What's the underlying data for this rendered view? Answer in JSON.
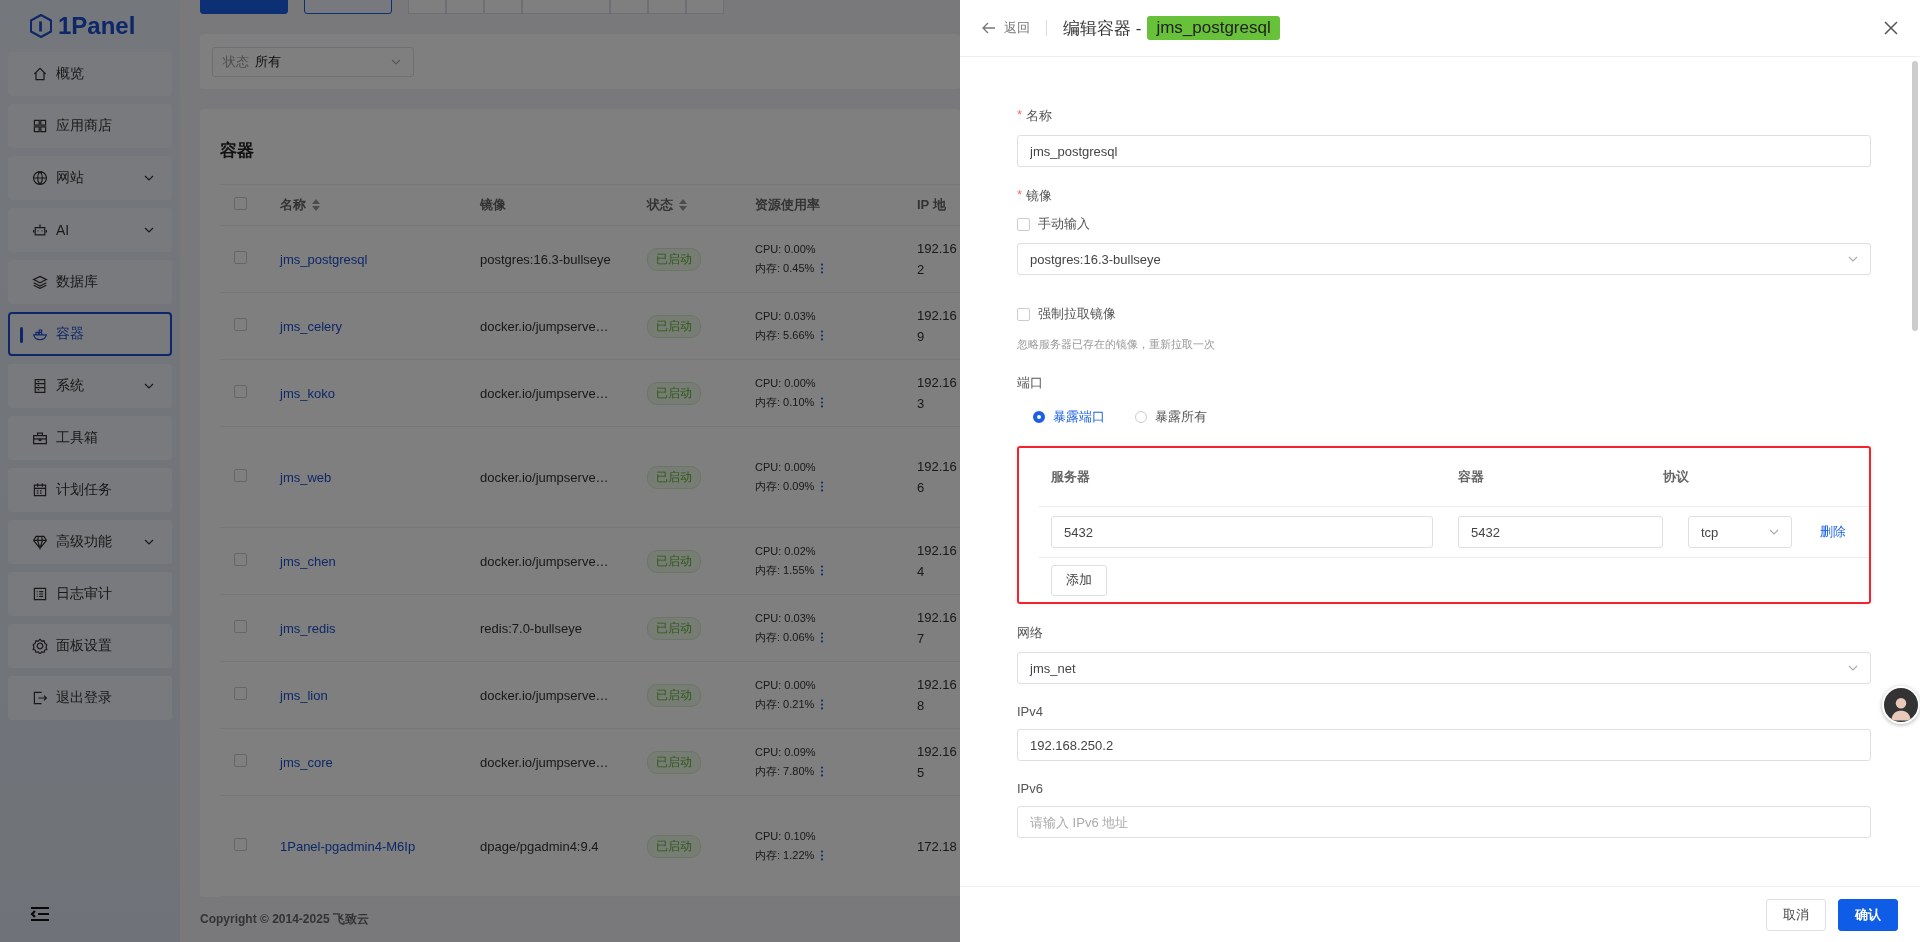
{
  "sidebar": {
    "logo": "1Panel",
    "items": [
      {
        "label": "概览",
        "selected": false,
        "expandable": false
      },
      {
        "label": "应用商店",
        "selected": false,
        "expandable": false
      },
      {
        "label": "网站",
        "selected": false,
        "expandable": true
      },
      {
        "label": "AI",
        "selected": false,
        "expandable": true
      },
      {
        "label": "数据库",
        "selected": false,
        "expandable": false
      },
      {
        "label": "容器",
        "selected": true,
        "expandable": false
      },
      {
        "label": "系统",
        "selected": false,
        "expandable": true
      },
      {
        "label": "工具箱",
        "selected": false,
        "expandable": false
      },
      {
        "label": "计划任务",
        "selected": false,
        "expandable": false
      },
      {
        "label": "高级功能",
        "selected": false,
        "expandable": true
      },
      {
        "label": "日志审计",
        "selected": false,
        "expandable": false
      },
      {
        "label": "面板设置",
        "selected": false,
        "expandable": false
      },
      {
        "label": "退出登录",
        "selected": false,
        "expandable": false
      }
    ]
  },
  "toolbar": {
    "buttons": [
      {
        "kind": "primary"
      },
      {
        "kind": "outline"
      },
      {
        "kind": "default"
      },
      {
        "kind": "default"
      },
      {
        "kind": "default"
      },
      {
        "kind": "default"
      },
      {
        "kind": "default"
      },
      {
        "kind": "default"
      },
      {
        "kind": "default"
      }
    ]
  },
  "filter": {
    "label": "状态",
    "value": "所有"
  },
  "table": {
    "title": "容器",
    "select_all_checked": false,
    "columns": [
      {
        "label": "名称",
        "sortable": true
      },
      {
        "label": "镜像",
        "sortable": false
      },
      {
        "label": "状态",
        "sortable": true
      },
      {
        "label": "资源使用率",
        "sortable": false
      },
      {
        "label": "IP 地",
        "sortable": false
      }
    ],
    "rows": [
      {
        "checked": false,
        "name": "jms_postgresql",
        "image": "postgres:16.3-bullseye",
        "status": "已启动",
        "cpu": "CPU: 0.00%",
        "memory": "内存: 0.45%",
        "ip": "192.16",
        "ip_line2": "2"
      },
      {
        "checked": false,
        "name": "jms_celery",
        "image": "docker.io/jumpserve…",
        "status": "已启动",
        "cpu": "CPU: 0.03%",
        "memory": "内存: 5.66%",
        "ip": "192.16",
        "ip_line2": "9"
      },
      {
        "checked": false,
        "name": "jms_koko",
        "image": "docker.io/jumpserve…",
        "status": "已启动",
        "cpu": "CPU: 0.00%",
        "memory": "内存: 0.10%",
        "ip": "192.16",
        "ip_line2": "3"
      },
      {
        "checked": false,
        "name": "jms_web",
        "image": "docker.io/jumpserve…",
        "status": "已启动",
        "cpu": "CPU: 0.00%",
        "memory": "内存: 0.09%",
        "ip": "192.16",
        "ip_line2": "6"
      },
      {
        "checked": false,
        "name": "jms_chen",
        "image": "docker.io/jumpserve…",
        "status": "已启动",
        "cpu": "CPU: 0.02%",
        "memory": "内存: 1.55%",
        "ip": "192.16",
        "ip_line2": "4"
      },
      {
        "checked": false,
        "name": "jms_redis",
        "image": "redis:7.0-bullseye",
        "status": "已启动",
        "cpu": "CPU: 0.03%",
        "memory": "内存: 0.06%",
        "ip": "192.16",
        "ip_line2": "7"
      },
      {
        "checked": false,
        "name": "jms_lion",
        "image": "docker.io/jumpserve…",
        "status": "已启动",
        "cpu": "CPU: 0.00%",
        "memory": "内存: 0.21%",
        "ip": "192.16",
        "ip_line2": "8"
      },
      {
        "checked": false,
        "name": "jms_core",
        "image": "docker.io/jumpserve…",
        "status": "已启动",
        "cpu": "CPU: 0.09%",
        "memory": "内存: 7.80%",
        "ip": "192.16",
        "ip_line2": "5"
      },
      {
        "checked": false,
        "name": "1Panel-pgadmin4-M6Ip",
        "image": "dpage/pgadmin4:9.4",
        "status": "已启动",
        "cpu": "CPU: 0.10%",
        "memory": "内存: 1.22%",
        "ip": "172.18"
      }
    ]
  },
  "footer": "Copyright © 2014-2025 飞致云",
  "drawer": {
    "back": "返回",
    "required_mark": "*",
    "title": "编辑容器 -",
    "tag": "jms_postgresql",
    "name_field": {
      "label": "名称",
      "required": true,
      "value": "jms_postgresql"
    },
    "image_field": {
      "label": "镜像",
      "required": true,
      "manual_input": {
        "label": "手动输入",
        "checked": false
      },
      "value": "postgres:16.3-bullseye"
    },
    "force_pull": {
      "label": "强制拉取镜像",
      "checked": false,
      "hint": "忽略服务器已存在的镜像，重新拉取一次"
    },
    "ports": {
      "label": "端口",
      "options": [
        {
          "label": "暴露端口",
          "selected": true
        },
        {
          "label": "暴露所有",
          "selected": false
        }
      ],
      "columns": [
        "服务器",
        "容器",
        "协议"
      ],
      "rows": [
        {
          "host": "5432",
          "container": "5432",
          "protocol": "tcp",
          "action": "删除"
        }
      ],
      "add": "添加"
    },
    "network": {
      "label": "网络",
      "value": "jms_net"
    },
    "ipv4": {
      "label": "IPv4",
      "value": "192.168.250.2"
    },
    "ipv6": {
      "label": "IPv6",
      "placeholder": "请输入 IPv6 地址"
    },
    "buttons": {
      "cancel": "取消",
      "confirm": "确认"
    }
  }
}
